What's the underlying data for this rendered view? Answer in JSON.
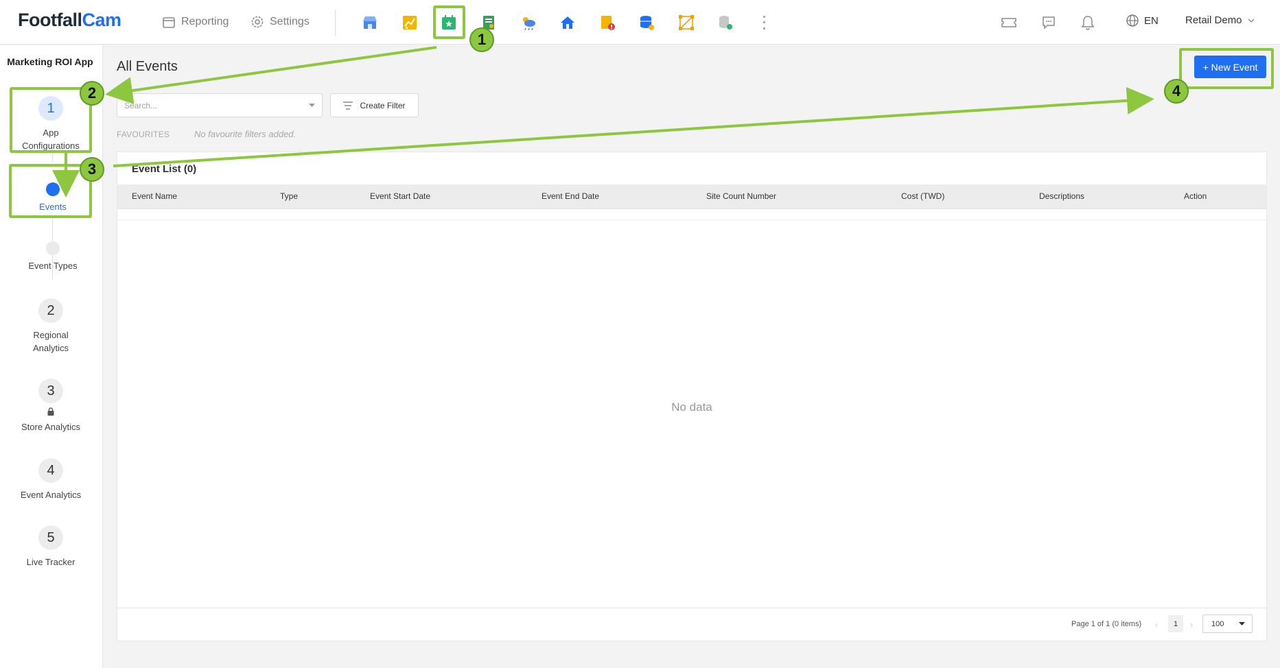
{
  "header": {
    "logo_part1": "Footfall",
    "logo_part2": "Cam",
    "nav_reporting": "Reporting",
    "nav_settings": "Settings",
    "language": "EN",
    "user": "Retail Demo",
    "app_icons": [
      "store-app-icon",
      "chart-app-icon",
      "calendar-star-app-icon",
      "receipt-app-icon",
      "weather-app-icon",
      "home-app-icon",
      "alert-doc-app-icon",
      "database-app-icon",
      "vector-app-icon",
      "data-sync-app-icon"
    ]
  },
  "sidebar": {
    "title": "Marketing ROI App",
    "steps": [
      {
        "number": "1",
        "label_line1": "App",
        "label_line2": "Configurations"
      },
      {
        "number": "2",
        "label_line1": "Regional",
        "label_line2": "Analytics"
      },
      {
        "number": "3",
        "label_line1": "Store Analytics"
      },
      {
        "number": "4",
        "label_line1": "Event Analytics"
      },
      {
        "number": "5",
        "label_line1": "Live Tracker"
      }
    ],
    "sub_steps": [
      {
        "label": "Events",
        "active": true
      },
      {
        "label": "Event Types",
        "active": false
      }
    ]
  },
  "main": {
    "title": "All Events",
    "new_event_label": "+ New Event",
    "search_placeholder": "Search...",
    "create_filter_label": "Create Filter",
    "favourites_label": "FAVOURITES",
    "favourites_empty": "No favourite filters added.",
    "panel_title": "Event List (0)",
    "columns": [
      "Event Name",
      "Type",
      "Event Start Date",
      "Event End Date",
      "Site Count Number",
      "Cost (TWD)",
      "Descriptions",
      "Action"
    ],
    "empty_text": "No data",
    "pagination": {
      "summary": "Page 1 of 1 (0 items)",
      "current_page": "1",
      "page_size": "100",
      "prev": "‹",
      "next": "›"
    }
  },
  "annotations": {
    "callouts": [
      "1",
      "2",
      "3",
      "4"
    ],
    "color": "#8dc63f"
  },
  "colors": {
    "accent": "#1e6ff2",
    "annotation_green": "#8dc63f"
  }
}
